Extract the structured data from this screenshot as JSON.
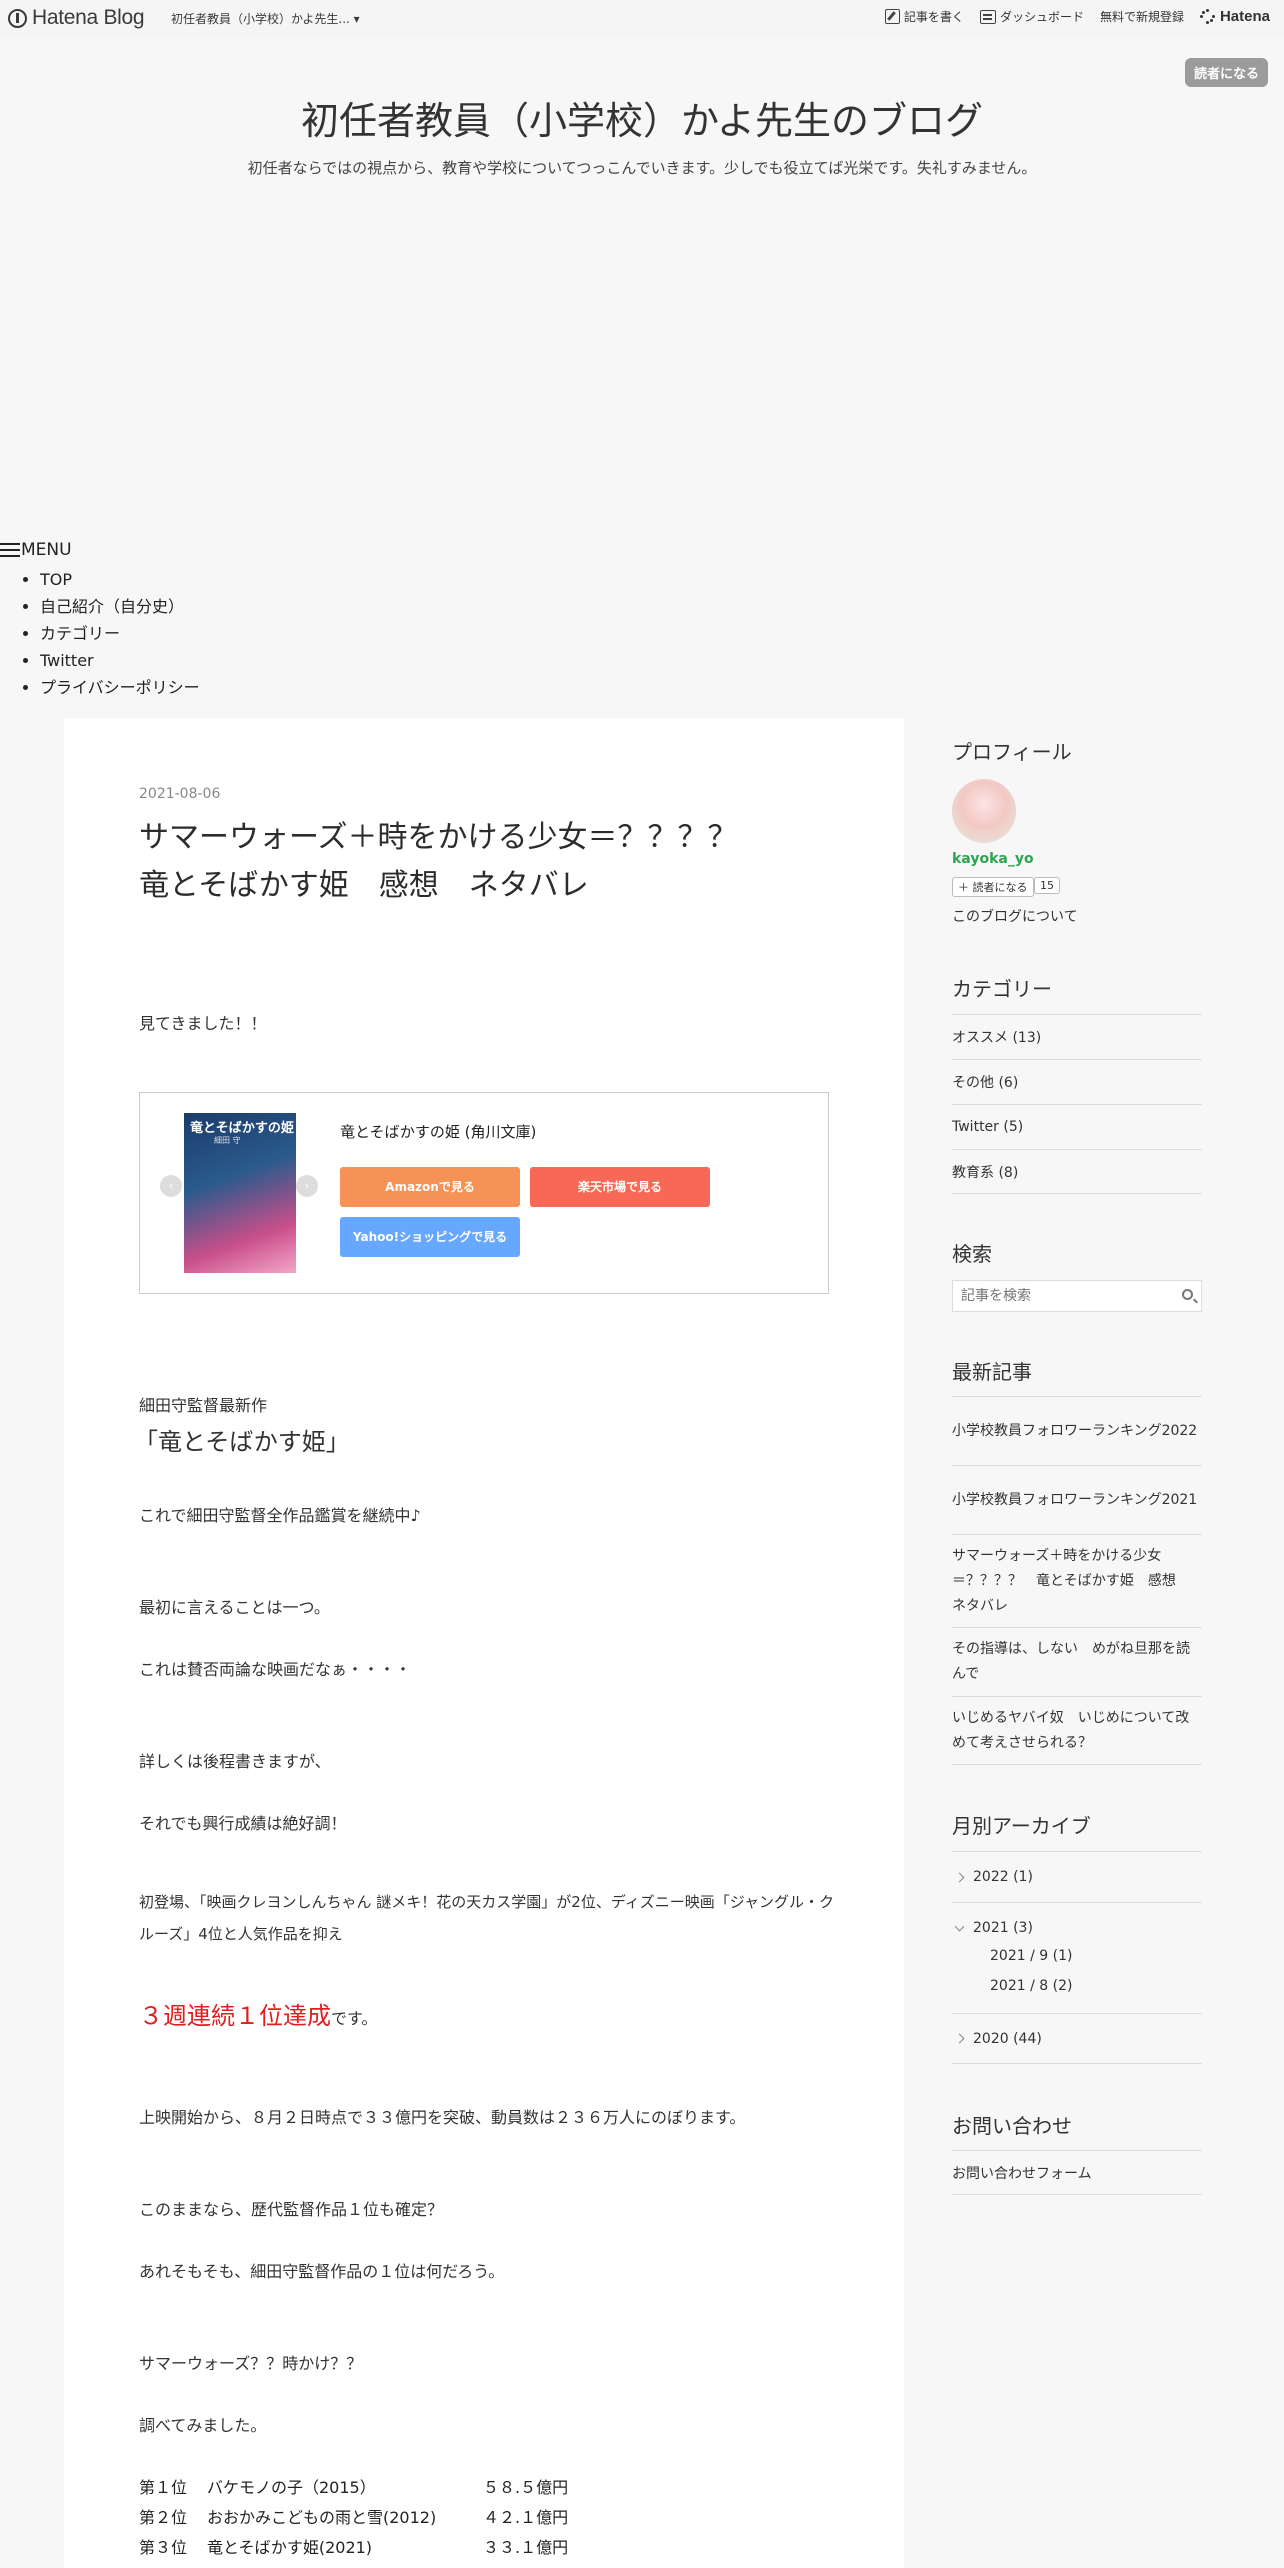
{
  "topbar": {
    "logo": "Hatena Blog",
    "blog_name": "初任者教員（小学校）かよ先生... ▾",
    "write": "記事を書く",
    "dashboard": "ダッシュボード",
    "signup": "無料で新規登録",
    "hatena": "Hatena",
    "subscribe": "読者になる"
  },
  "header": {
    "title": "初任者教員（小学校）かよ先生のブログ",
    "description": "初任者ならではの視点から、教育や学校についてつっこんでいきます。少しでも役立てば光栄です。失礼すみません。"
  },
  "menu": {
    "label": "MENU",
    "items": [
      "TOP",
      "自己紹介（自分史）",
      "カテゴリー",
      "Twitter",
      "プライバシーポリシー"
    ]
  },
  "post": {
    "date": "2021-08-06",
    "title_line1": "サマーウォーズ＋時をかける少女＝？？？？",
    "title_line2": "竜とそばかす姫　感想　ネタバレ",
    "p_seen": "見てきました！！",
    "product": {
      "cover_title": "竜とそばかすの姫",
      "cover_author": "細田 守",
      "title": "竜とそばかすの姫 (角川文庫)",
      "amazon": "Amazonで見る",
      "rakuten": "楽天市場で見る",
      "yahoo": "Yahoo!ショッピングで見る"
    },
    "sub_heading": "細田守監督最新作",
    "heading": "「竜とそばかす姫」",
    "p1": "これで細田守監督全作品鑑賞を継続中♪",
    "p2": "最初に言えることは一つ。",
    "p3": "これは賛否両論な映画だなぁ・・・・",
    "p4": "詳しくは後程書きますが、",
    "p5": "それでも興行成績は絶好調！",
    "p6": "初登場、「映画クレヨンしんちゃん 謎メキ！花の天カス学園」が2位、ディズニー映画「ジャングル・クルーズ」4位と人気作品を抑え",
    "p7_red": "３週連続１位達成",
    "p7_rest": "です。",
    "p8": "上映開始から、８月２日時点で３３億円を突破、動員数は２３６万人にのぼります。",
    "p9": "このままなら、歴代監督作品１位も確定？",
    "p10": "あれそもそも、細田守監督作品の１位は何だろう。",
    "p11": "サマーウォーズ？？時かけ？？",
    "p12": "調べてみました。",
    "ranking": [
      {
        "rank": "第１位",
        "title": "バケモノの子（2015）",
        "gross": "５８.５億円"
      },
      {
        "rank": "第２位",
        "title": "おおかみこどもの雨と雪(2012)",
        "gross": "４２.１億円"
      },
      {
        "rank": "第３位",
        "title": "竜とそばかす姫(2021)",
        "gross": "３３.１億円"
      }
    ]
  },
  "sidebar": {
    "profile_title": "プロフィール",
    "username": "kayoka_yo",
    "reader_button": "読者になる",
    "reader_count": "15",
    "about": "このブログについて",
    "category_title": "カテゴリー",
    "categories": [
      "オススメ (13)",
      "その他 (6)",
      "Twitter (5)",
      "教育系 (8)"
    ],
    "search_title": "検索",
    "search_placeholder": "記事を検索",
    "recent_title": "最新記事",
    "recent": [
      "小学校教員フォロワーランキング2022",
      "小学校教員フォロワーランキング2021",
      "サマーウォーズ＋時をかける少女＝？？？？　竜とそばかす姫　感想　ネタバレ",
      "その指導は、しない　めがね旦那を読んで",
      "いじめるヤバイ奴　いじめについて改めて考えさせられる？"
    ],
    "archive_title": "月別アーカイブ",
    "archive": {
      "y2022": "2022 (1)",
      "y2021": "2021 (3)",
      "m1": "2021 / 9 (1)",
      "m2": "2021 / 8 (2)",
      "y2020": "2020 (44)"
    },
    "contact_title": "お問い合わせ",
    "contact_link": "お問い合わせフォーム"
  }
}
